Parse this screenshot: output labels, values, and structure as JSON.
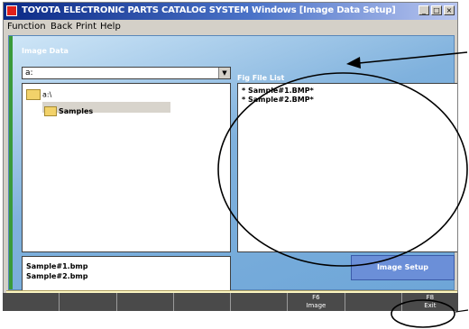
{
  "title_bar": {
    "text": "TOYOTA ELECTRONIC PARTS CATALOG SYSTEM  Windows  [Image Data Setup]",
    "buttons": [
      "_",
      "□",
      "×"
    ]
  },
  "menu": [
    "Function",
    "Back",
    "Print",
    "Help"
  ],
  "image_data": {
    "label": "Image Data",
    "drive_value": "a:",
    "tree_root": "a:\\",
    "tree_child": "Samples"
  },
  "file_list": [
    "Sample#1.bmp",
    "Sample#2.bmp"
  ],
  "fig_file_list": {
    "label": "Fig File List",
    "items": [
      "* Sample#1.BMP*",
      "* Sample#2.BMP*"
    ]
  },
  "image_setup_button": "Image Setup",
  "function_keys": [
    {
      "key": "",
      "label": ""
    },
    {
      "key": "",
      "label": ""
    },
    {
      "key": "",
      "label": ""
    },
    {
      "key": "",
      "label": ""
    },
    {
      "key": "",
      "label": ""
    },
    {
      "key": "F6",
      "label": "Image"
    },
    {
      "key": "",
      "label": ""
    },
    {
      "key": "F8",
      "label": "Exit"
    }
  ]
}
